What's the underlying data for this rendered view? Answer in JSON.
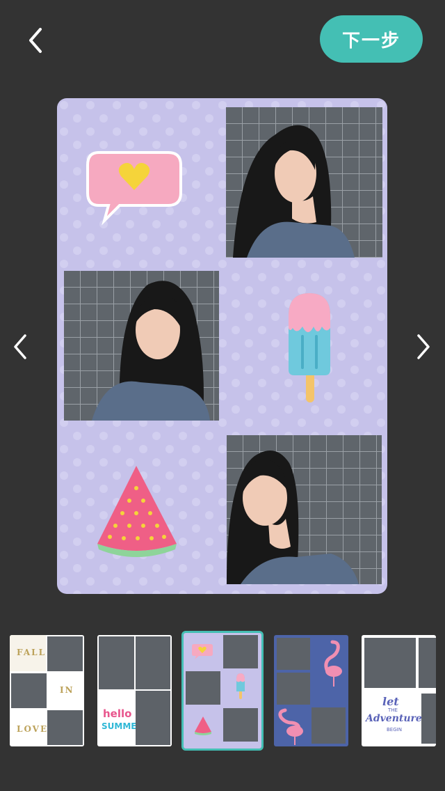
{
  "header": {
    "back_icon": "chevron-left-icon",
    "next_label": "下一步",
    "accent_color": "#44bfb4"
  },
  "nav": {
    "prev_icon": "chevron-left-icon",
    "next_icon": "chevron-right-icon"
  },
  "canvas": {
    "background_color": "#c6c2ea",
    "stickers": [
      "speech-bubble-heart",
      "popsicle",
      "watermelon-slice"
    ],
    "photo_count": 3
  },
  "templates": [
    {
      "name": "fall-in-love",
      "words": [
        "FALL",
        "IN",
        "LOVE"
      ],
      "selected": false
    },
    {
      "name": "hello-summer",
      "words": [
        "hello",
        "SUMMER"
      ],
      "selected": false
    },
    {
      "name": "pastel-stickers",
      "words": [],
      "selected": true
    },
    {
      "name": "flamingo",
      "words": [],
      "selected": false
    },
    {
      "name": "adventure",
      "words": [
        "let",
        "THE",
        "Adventure",
        "BEGIN"
      ],
      "selected": false
    }
  ]
}
